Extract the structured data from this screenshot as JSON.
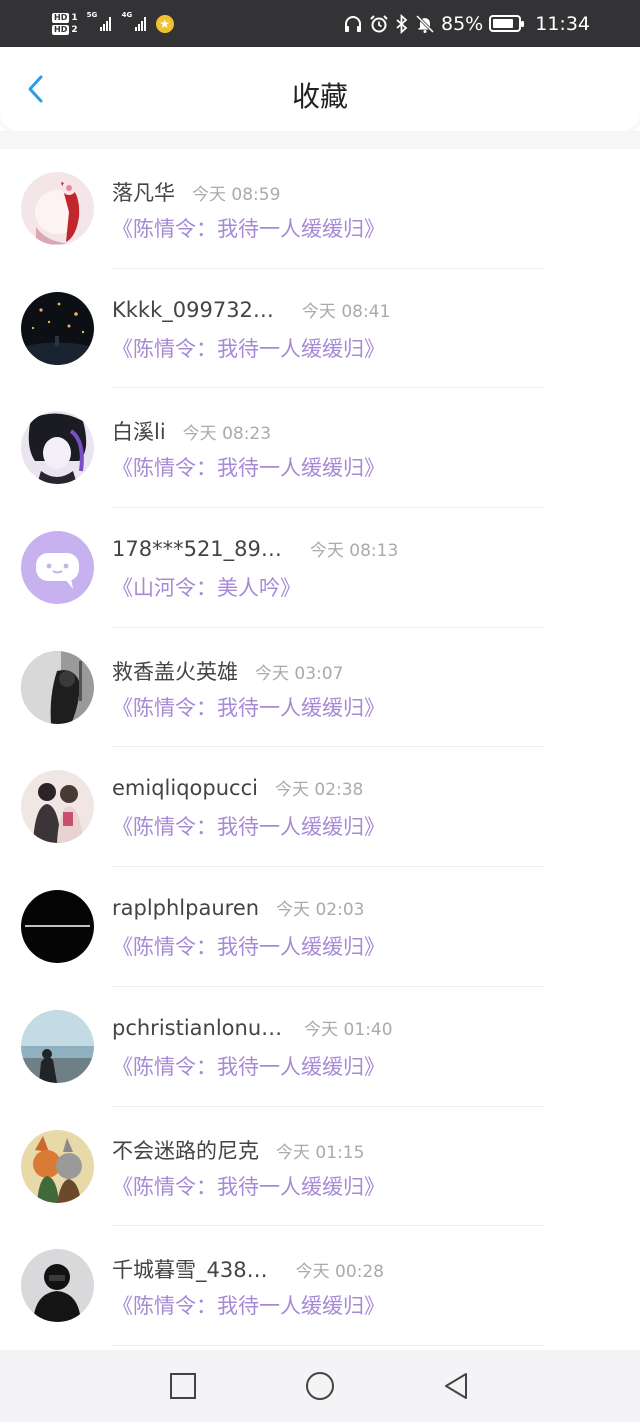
{
  "status_bar": {
    "hd1": "HD",
    "hd1_num": "1",
    "hd2": "HD",
    "hd2_num": "2",
    "net1": "5G",
    "net2": "4G",
    "battery_percent": "85%",
    "battery_level": 0.85,
    "time": "11:34",
    "icons": [
      "headphones-icon",
      "alarm-icon",
      "bluetooth-icon",
      "mute-bell-icon",
      "battery-icon"
    ]
  },
  "header": {
    "title": "收藏",
    "back_icon": "chevron-left-icon",
    "accent": "#2d9ce8"
  },
  "colors": {
    "work_link": "#a68ad6",
    "name": "#444444",
    "time": "#aaaaaa"
  },
  "items": [
    {
      "name": "落凡华",
      "time": "今天 08:59",
      "work": "《陈情令：我待一人缓缓归》"
    },
    {
      "name": "Kkkk_099732…",
      "time": "今天 08:41",
      "work": "《陈情令：我待一人缓缓归》"
    },
    {
      "name": "白溪li",
      "time": "今天 08:23",
      "work": "《陈情令：我待一人缓缓归》"
    },
    {
      "name": "178***521_89…",
      "time": "今天 08:13",
      "work": "《山河令：美人吟》"
    },
    {
      "name": "救香盖火英雄",
      "time": "今天 03:07",
      "work": "《陈情令：我待一人缓缓归》"
    },
    {
      "name": "emiqliqopucci",
      "time": "今天 02:38",
      "work": "《陈情令：我待一人缓缓归》"
    },
    {
      "name": "raplphlpauren",
      "time": "今天 02:03",
      "work": "《陈情令：我待一人缓缓归》"
    },
    {
      "name": "pchristianlonu…",
      "time": "今天 01:40",
      "work": "《陈情令：我待一人缓缓归》"
    },
    {
      "name": "不会迷路的尼克",
      "time": "今天 01:15",
      "work": "《陈情令：我待一人缓缓归》"
    },
    {
      "name": "千城暮雪_438…",
      "time": "今天 00:28",
      "work": "《陈情令：我待一人缓缓归》"
    }
  ],
  "navbar": {
    "icons": [
      "recent-apps-square-icon",
      "home-circle-icon",
      "back-triangle-icon"
    ]
  }
}
